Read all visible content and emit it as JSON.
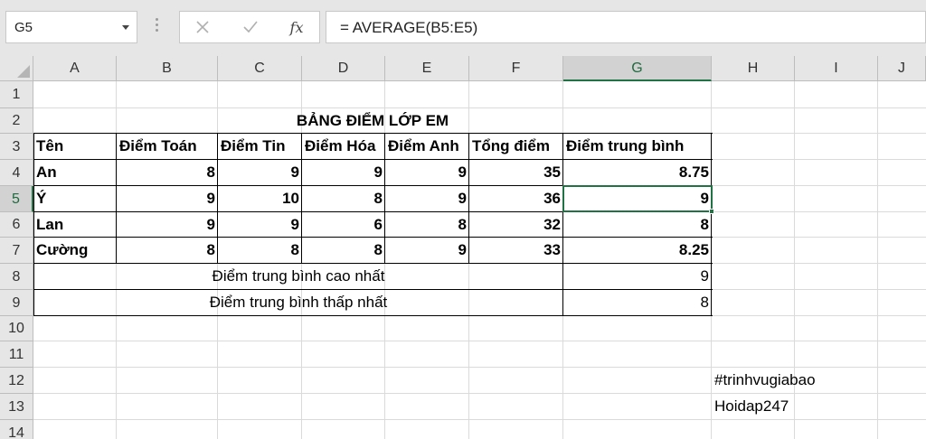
{
  "formula_bar": {
    "name_box": "G5",
    "cancel_icon": "✕",
    "enter_icon": "✓",
    "fx_label": "fx",
    "formula": "= AVERAGE(B5:E5)"
  },
  "columns": [
    "A",
    "B",
    "C",
    "D",
    "E",
    "F",
    "G",
    "H",
    "I",
    "J"
  ],
  "rows": [
    "1",
    "2",
    "3",
    "4",
    "5",
    "6",
    "7",
    "8",
    "9",
    "10",
    "11",
    "12",
    "13",
    "14"
  ],
  "selected_cell": "G5",
  "sheet": {
    "title": "BẢNG ĐIỂM LỚP EM",
    "headers": [
      "Tên",
      "Điểm Toán",
      "Điểm Tin",
      "Điểm Hóa",
      "Điểm Anh",
      "Tổng điểm",
      "Điểm trung bình"
    ],
    "records": [
      [
        "An",
        "8",
        "9",
        "9",
        "9",
        "35",
        "8.75"
      ],
      [
        "Ý",
        "9",
        "10",
        "8",
        "9",
        "36",
        "9"
      ],
      [
        "Lan",
        "9",
        "9",
        "6",
        "8",
        "32",
        "8"
      ],
      [
        "Cường",
        "8",
        "8",
        "8",
        "9",
        "33",
        "8.25"
      ]
    ],
    "max_label": "Điểm trung bình cao nhất",
    "max_value": "9",
    "min_label": "Điểm trung bình thấp nhất",
    "min_value": "8",
    "note1": "#trinhvugiabao",
    "note2": "Hoidap247"
  }
}
